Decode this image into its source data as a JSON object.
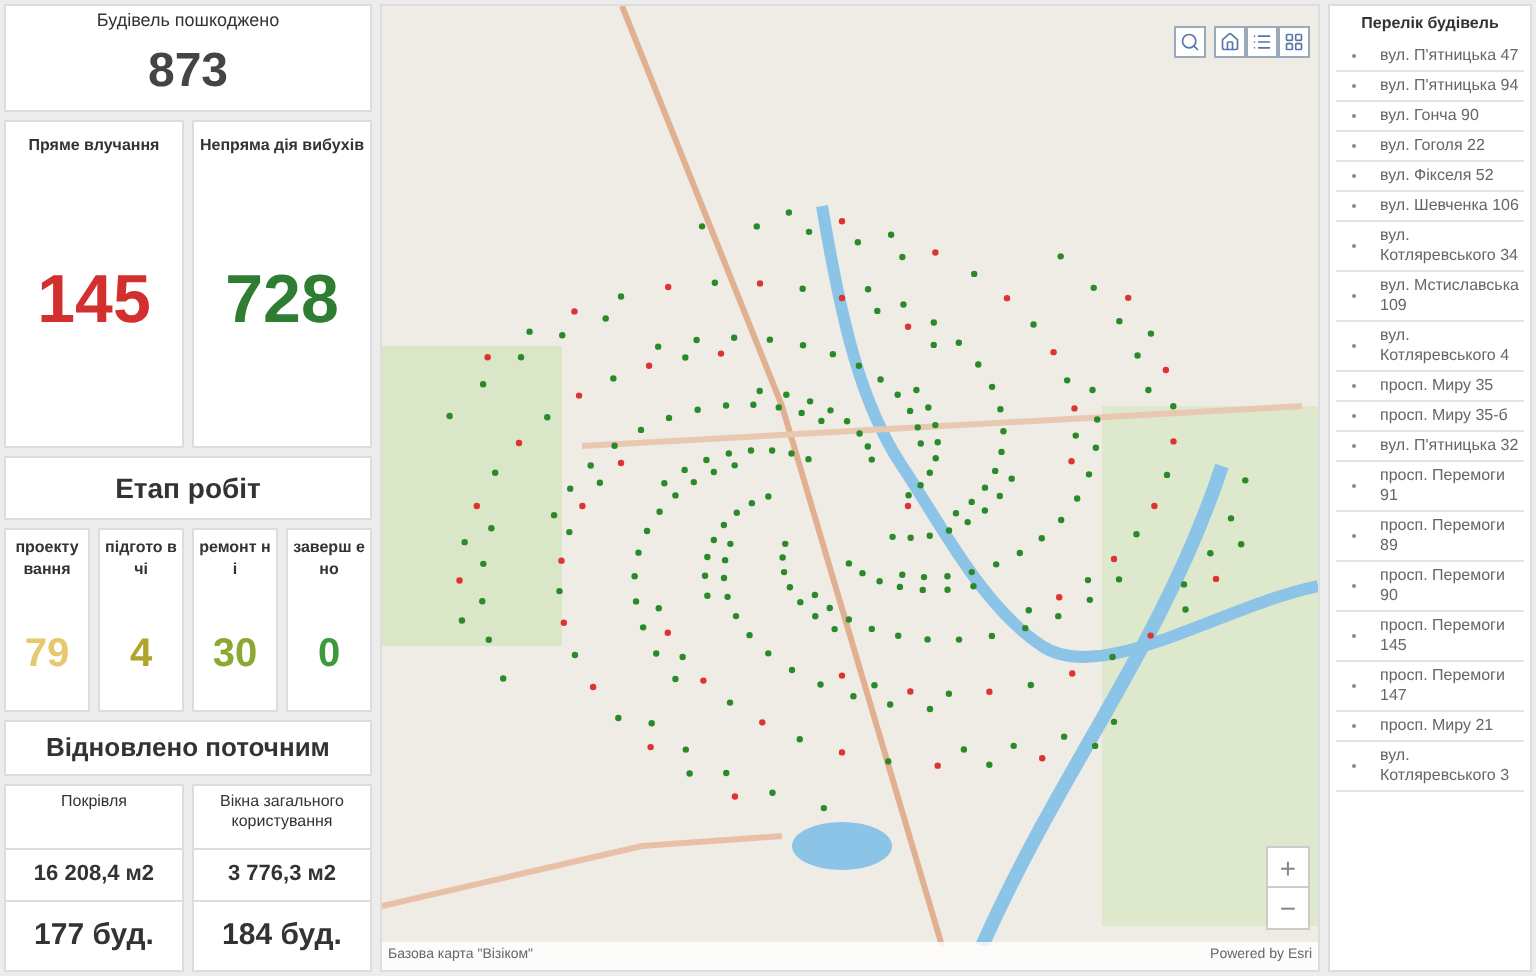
{
  "total": {
    "title": "Будівель пошкоджено",
    "value": "873"
  },
  "damage": [
    {
      "title": "Пряме влучання",
      "value": "145",
      "color": "#d32f2f"
    },
    {
      "title": "Непряма дія вибухів",
      "value": "728",
      "color": "#2e7d32"
    }
  ],
  "stages": {
    "title": "Етап робіт",
    "items": [
      {
        "label": "проекту вання",
        "value": "79",
        "color": "#e6c86e"
      },
      {
        "label": "підгото вчі",
        "value": "4",
        "color": "#b0a42a"
      },
      {
        "label": "ремонт ні",
        "value": "30",
        "color": "#8aa832"
      },
      {
        "label": "заверш ено",
        "value": "0",
        "color": "#3c9a3c"
      }
    ]
  },
  "restored": {
    "title": "Відновлено поточним",
    "columns": [
      {
        "title": "Покрівля",
        "area": "16 208,4 м2",
        "count": "177 буд."
      },
      {
        "title": "Вікна загального користування",
        "area": "3 776,3 м2",
        "count": "184 буд."
      }
    ]
  },
  "map": {
    "attribution": "Базова карта \"Візіком\"",
    "powered_by": "Powered by Esri",
    "zoom_in": "+",
    "zoom_out": "−"
  },
  "buildings": {
    "title": "Перелік будівель",
    "items": [
      "вул. П'ятницька 47",
      "вул. П'ятницька 94",
      "вул. Гонча 90",
      "вул. Гоголя 22",
      "вул. Фікселя 52",
      "вул. Шевченка 106",
      "вул. Котляревського 34",
      "вул. Мстиславська 109",
      "вул. Котляревського 4",
      "просп. Миру 35",
      "просп. Миру 35-б",
      "вул. П'ятницька 32",
      "просп. Перемоги 91",
      "просп. Перемоги 89",
      "просп. Перемоги 90",
      "просп. Перемоги 145",
      "просп. Перемоги 147",
      "просп. Миру 21",
      "вул. Котляревського 3"
    ]
  }
}
